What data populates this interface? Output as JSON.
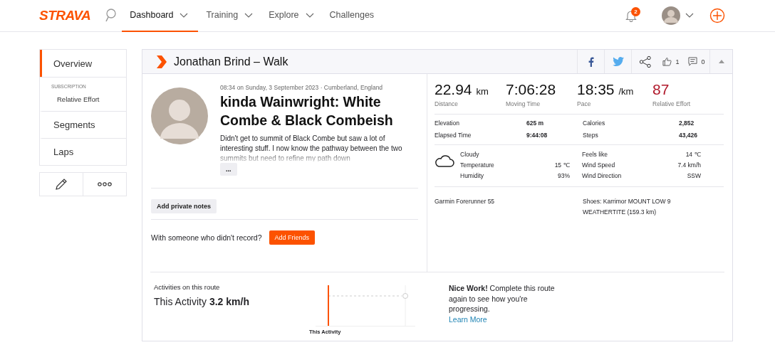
{
  "nav": {
    "logo": "STRAVA",
    "items": [
      {
        "label": "Dashboard",
        "selected": true,
        "dropdown": true
      },
      {
        "label": "Training",
        "selected": false,
        "dropdown": true
      },
      {
        "label": "Explore",
        "selected": false,
        "dropdown": true
      },
      {
        "label": "Challenges",
        "selected": false,
        "dropdown": false
      }
    ],
    "notification_count": "2"
  },
  "sidebar": {
    "items": [
      {
        "label": "Overview",
        "kind": "main",
        "selected": true
      },
      {
        "label": "SUBSCRIPTION",
        "kind": "heading"
      },
      {
        "label": "Relative Effort",
        "kind": "sub",
        "selected": false
      },
      {
        "label": "Segments",
        "kind": "main",
        "selected": false
      },
      {
        "label": "Laps",
        "kind": "main",
        "selected": false
      }
    ]
  },
  "activity": {
    "header": "Jonathan Brind – Walk",
    "kudos": "1",
    "comments": "0",
    "meta": "08:34 on Sunday, 3 September 2023 · Cumberland, England",
    "title": "kinda Wainwright: White Combe & Black Combeish",
    "description": "Didn't get to summit of Black Combe but saw a lot of interesting stuff. I now know the pathway between the two summits but need to refine my path down",
    "more_button": "...",
    "private_notes_button": "Add private notes",
    "friends_prompt": "With someone who didn't record?",
    "friends_button": "Add Friends",
    "stats": [
      {
        "value": "22.94",
        "unit": "km",
        "label": "Distance",
        "highlight": false
      },
      {
        "value": "7:06:28",
        "label": "Moving Time",
        "highlight": false
      },
      {
        "value": "18:35",
        "unit": "/km",
        "label": "Pace",
        "highlight": false
      },
      {
        "value": "87",
        "label": "Relative Effort",
        "highlight": true
      }
    ],
    "details": [
      {
        "label": "Elevation",
        "value": "625 m"
      },
      {
        "label": "Calories",
        "value": "2,852"
      },
      {
        "label": "Elapsed Time",
        "value": "9:44:08"
      },
      {
        "label": "Steps",
        "value": "43,426"
      }
    ],
    "weather": {
      "condition": "Cloudy",
      "left": [
        {
          "label": "Temperature",
          "value": "15 ℃"
        },
        {
          "label": "Humidity",
          "value": "93%"
        }
      ],
      "right": [
        {
          "label": "Feels like",
          "value": "14 ℃"
        },
        {
          "label": "Wind Speed",
          "value": "7.4 km/h"
        },
        {
          "label": "Wind Direction",
          "value": "SSW"
        }
      ]
    },
    "device": "Garmin Forerunner 55",
    "shoes": "Shoes: Karrimor MOUNT LOW 9 WEATHERTITE (159.3 km)"
  },
  "route": {
    "heading": "Activities on this route",
    "label": "This Activity",
    "value": "3.2 km/h",
    "chart_label": "This Activity",
    "message": "**Nice Work!** Complete this route again to see how you're progressing.",
    "link": "Learn More"
  }
}
